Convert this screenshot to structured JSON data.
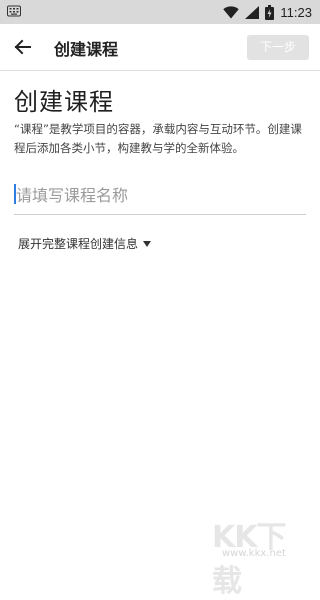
{
  "status_bar": {
    "time": "11:23",
    "icons": [
      "keyboard-icon",
      "wifi-icon",
      "signal-icon",
      "battery-icon"
    ]
  },
  "toolbar": {
    "title": "创建课程",
    "next_label": "下一步"
  },
  "main": {
    "heading": "创建课程",
    "description": "“课程”是教学项目的容器，承载内容与互动环节。创建课程后添加各类小节，构建教与学的全新体验。",
    "name_placeholder": "请填写课程名称",
    "expand_label": "展开完整课程创建信息"
  },
  "watermark": {
    "text": "KK下载",
    "url": "www.kkx.net"
  }
}
